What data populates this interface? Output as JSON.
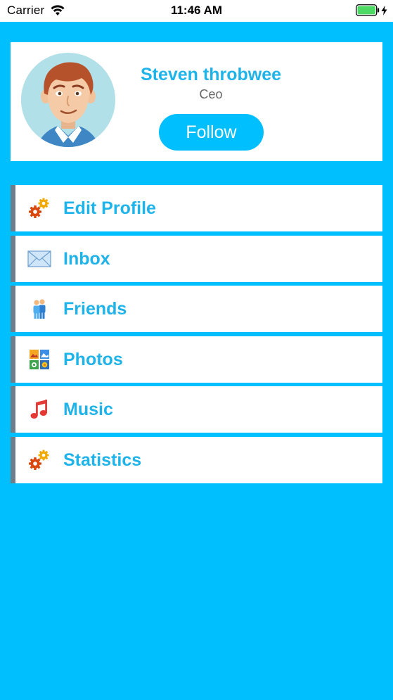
{
  "status_bar": {
    "carrier": "Carrier",
    "time": "11:46 AM",
    "wifi_icon": "wifi-icon",
    "battery_icon": "battery-icon"
  },
  "profile": {
    "name": "Steven throbwee",
    "role": "Ceo",
    "follow_label": "Follow",
    "avatar_icon": "cartoon-man-avatar"
  },
  "menu": {
    "items": [
      {
        "label": "Edit Profile",
        "icon": "gears-icon"
      },
      {
        "label": "Inbox",
        "icon": "envelope-icon"
      },
      {
        "label": "Friends",
        "icon": "people-icon"
      },
      {
        "label": "Photos",
        "icon": "photos-grid-icon"
      },
      {
        "label": "Music",
        "icon": "music-note-icon"
      },
      {
        "label": "Statistics",
        "icon": "gears-icon"
      }
    ]
  },
  "colors": {
    "background": "#00BFFF",
    "accent_text": "#1EB3E9",
    "menu_border": "#6E7D8A",
    "battery": "#4CD964"
  }
}
